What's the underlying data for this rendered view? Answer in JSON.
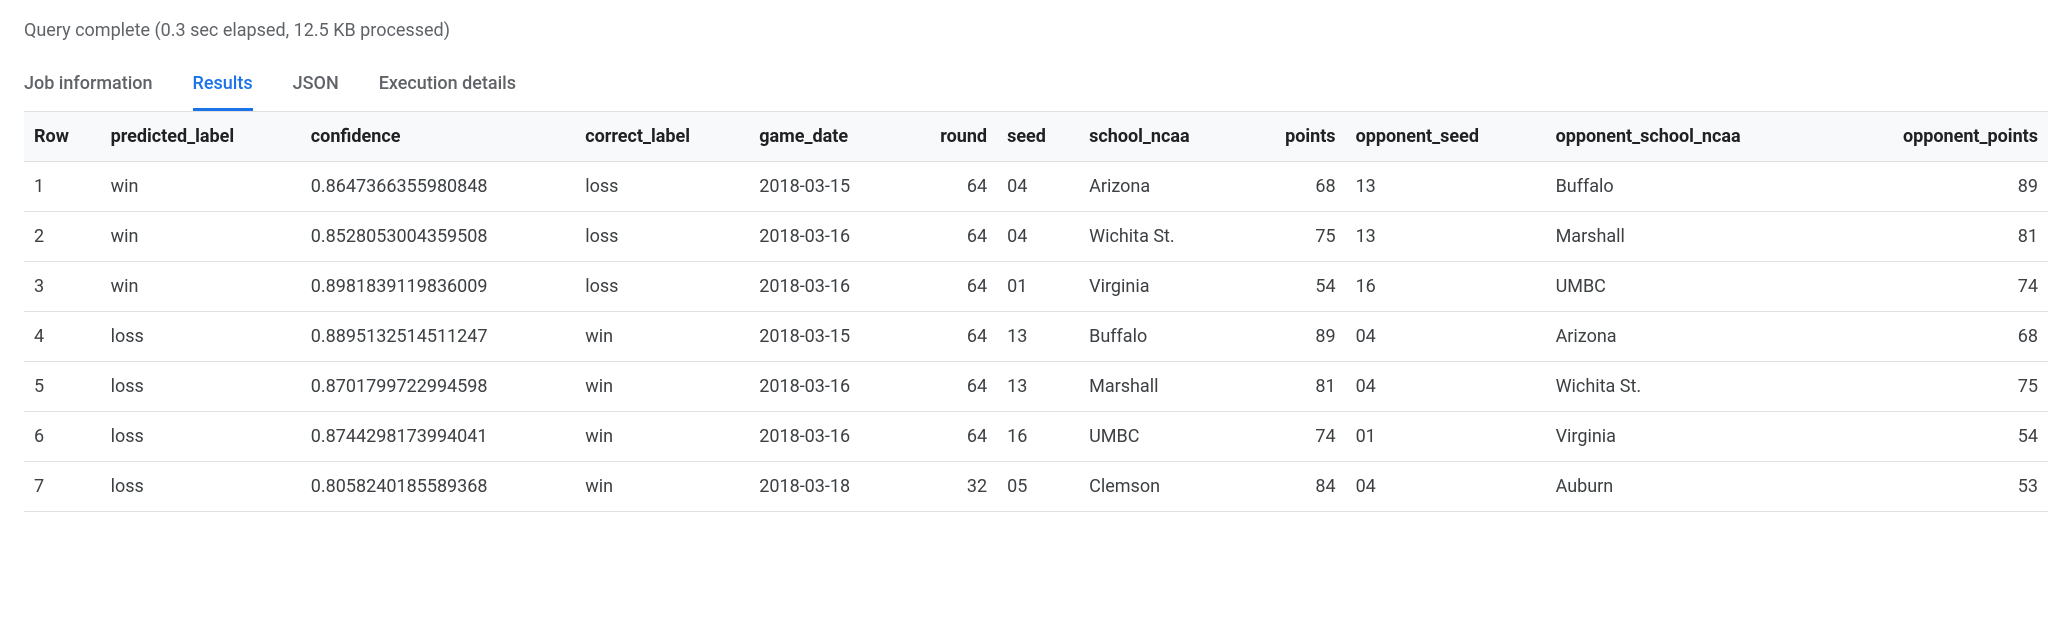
{
  "status": "Query complete (0.3 sec elapsed, 12.5 KB processed)",
  "tabs": {
    "job_information": "Job information",
    "results": "Results",
    "json": "JSON",
    "execution_details": "Execution details"
  },
  "table": {
    "headers": {
      "row": "Row",
      "predicted_label": "predicted_label",
      "confidence": "confidence",
      "correct_label": "correct_label",
      "game_date": "game_date",
      "round": "round",
      "seed": "seed",
      "school_ncaa": "school_ncaa",
      "points": "points",
      "opponent_seed": "opponent_seed",
      "opponent_school_ncaa": "opponent_school_ncaa",
      "opponent_points": "opponent_points"
    },
    "rows": [
      {
        "row": "1",
        "predicted_label": "win",
        "confidence": "0.8647366355980848",
        "correct_label": "loss",
        "game_date": "2018-03-15",
        "round": "64",
        "seed": "04",
        "school_ncaa": "Arizona",
        "points": "68",
        "opponent_seed": "13",
        "opponent_school_ncaa": "Buffalo",
        "opponent_points": "89"
      },
      {
        "row": "2",
        "predicted_label": "win",
        "confidence": "0.8528053004359508",
        "correct_label": "loss",
        "game_date": "2018-03-16",
        "round": "64",
        "seed": "04",
        "school_ncaa": "Wichita St.",
        "points": "75",
        "opponent_seed": "13",
        "opponent_school_ncaa": "Marshall",
        "opponent_points": "81"
      },
      {
        "row": "3",
        "predicted_label": "win",
        "confidence": "0.8981839119836009",
        "correct_label": "loss",
        "game_date": "2018-03-16",
        "round": "64",
        "seed": "01",
        "school_ncaa": "Virginia",
        "points": "54",
        "opponent_seed": "16",
        "opponent_school_ncaa": "UMBC",
        "opponent_points": "74"
      },
      {
        "row": "4",
        "predicted_label": "loss",
        "confidence": "0.8895132514511247",
        "correct_label": "win",
        "game_date": "2018-03-15",
        "round": "64",
        "seed": "13",
        "school_ncaa": "Buffalo",
        "points": "89",
        "opponent_seed": "04",
        "opponent_school_ncaa": "Arizona",
        "opponent_points": "68"
      },
      {
        "row": "5",
        "predicted_label": "loss",
        "confidence": "0.8701799722994598",
        "correct_label": "win",
        "game_date": "2018-03-16",
        "round": "64",
        "seed": "13",
        "school_ncaa": "Marshall",
        "points": "81",
        "opponent_seed": "04",
        "opponent_school_ncaa": "Wichita St.",
        "opponent_points": "75"
      },
      {
        "row": "6",
        "predicted_label": "loss",
        "confidence": "0.8744298173994041",
        "correct_label": "win",
        "game_date": "2018-03-16",
        "round": "64",
        "seed": "16",
        "school_ncaa": "UMBC",
        "points": "74",
        "opponent_seed": "01",
        "opponent_school_ncaa": "Virginia",
        "opponent_points": "54"
      },
      {
        "row": "7",
        "predicted_label": "loss",
        "confidence": "0.8058240185589368",
        "correct_label": "win",
        "game_date": "2018-03-18",
        "round": "32",
        "seed": "05",
        "school_ncaa": "Clemson",
        "points": "84",
        "opponent_seed": "04",
        "opponent_school_ncaa": "Auburn",
        "opponent_points": "53"
      }
    ]
  }
}
